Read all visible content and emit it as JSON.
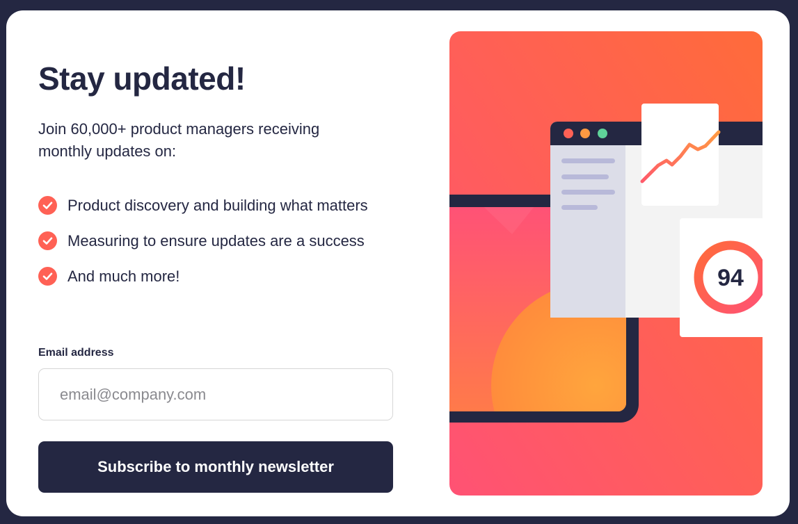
{
  "signup": {
    "title": "Stay updated!",
    "intro": "Join 60,000+ product managers receiving monthly updates on:",
    "features": [
      {
        "icon": "check-circle-icon",
        "label": "Product discovery and building what matters"
      },
      {
        "icon": "check-circle-icon",
        "label": "Measuring to ensure updates are a success"
      },
      {
        "icon": "check-circle-icon",
        "label": "And much more!"
      }
    ],
    "email": {
      "label": "Email address",
      "placeholder": "email@company.com",
      "value": ""
    },
    "subscribe_label": "Subscribe to monthly newsletter"
  },
  "illustration": {
    "score": "94",
    "window_dots": [
      "#ff6155",
      "#ff9a42",
      "#5fd39a"
    ]
  },
  "colors": {
    "background": "#242742",
    "card": "#ffffff",
    "accent": "#ff6155",
    "text": "#242742",
    "button": "#242742"
  }
}
